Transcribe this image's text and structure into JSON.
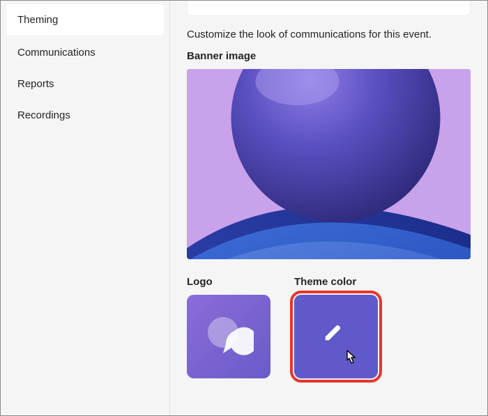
{
  "sidebar": {
    "items": [
      {
        "label": "Theming",
        "active": true
      },
      {
        "label": "Communications",
        "active": false
      },
      {
        "label": "Reports",
        "active": false
      },
      {
        "label": "Recordings",
        "active": false
      }
    ]
  },
  "main": {
    "description": "Customize the look of communications for this event.",
    "banner_label": "Banner image",
    "logo_label": "Logo",
    "theme_color_label": "Theme color"
  },
  "colors": {
    "theme_tile": "#6059c9",
    "highlight": "#e8352c"
  }
}
